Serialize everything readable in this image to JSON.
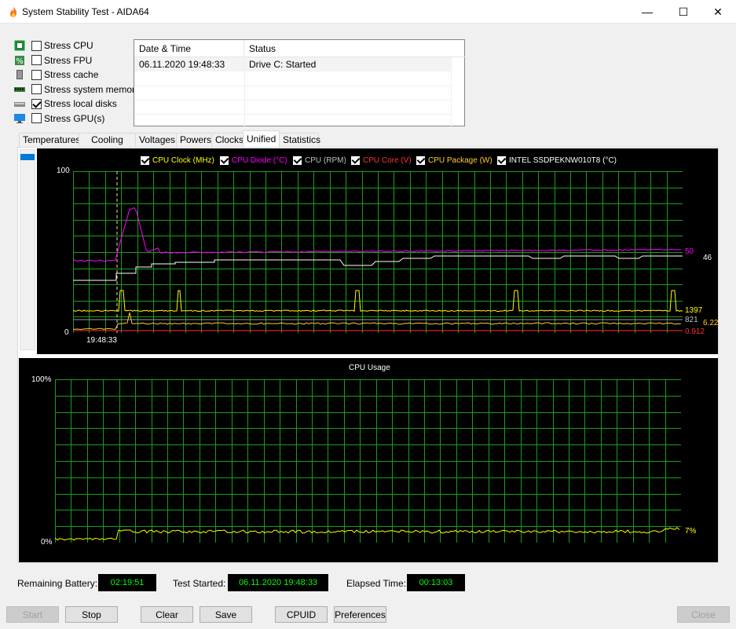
{
  "window": {
    "title": "System Stability Test - AIDA64",
    "controls": {
      "minimize": "—",
      "maximize": "☐",
      "close": "✕"
    }
  },
  "stress_options": [
    {
      "label": "Stress CPU",
      "checked": false,
      "icon": "cpu-icon"
    },
    {
      "label": "Stress FPU",
      "checked": false,
      "icon": "fpu-icon"
    },
    {
      "label": "Stress cache",
      "checked": false,
      "icon": "cache-icon"
    },
    {
      "label": "Stress system memory",
      "checked": false,
      "icon": "memory-icon"
    },
    {
      "label": "Stress local disks",
      "checked": true,
      "icon": "disk-icon"
    },
    {
      "label": "Stress GPU(s)",
      "checked": false,
      "icon": "monitor-icon"
    }
  ],
  "log": {
    "headers": [
      "Date & Time",
      "Status"
    ],
    "rows": [
      [
        "06.11.2020 19:48:33",
        "Drive C: Started"
      ]
    ]
  },
  "tabs": [
    {
      "label": "Temperatures",
      "active": false
    },
    {
      "label": "Cooling Fans",
      "active": false
    },
    {
      "label": "Voltages",
      "active": false
    },
    {
      "label": "Powers",
      "active": false
    },
    {
      "label": "Clocks",
      "active": false
    },
    {
      "label": "Unified",
      "active": true
    },
    {
      "label": "Statistics",
      "active": false
    }
  ],
  "unified_chart": {
    "y_max_label": "100",
    "y_min_label": "0",
    "x_time_label": "19:48:33",
    "legend": [
      {
        "label": "CPU Clock (MHz)",
        "color": "#ffff00",
        "checked": true
      },
      {
        "label": "CPU Diode (°C)",
        "color": "#ff00ff",
        "checked": true
      },
      {
        "label": "CPU (RPM)",
        "color": "#c0c0c0",
        "checked": true
      },
      {
        "label": "CPU Core (V)",
        "color": "#ff3333",
        "checked": true
      },
      {
        "label": "CPU Package (W)",
        "color": "#ffcc33",
        "checked": true
      },
      {
        "label": "INTEL SSDPEKNW010T8 (°C)",
        "color": "#ffffff",
        "checked": true
      }
    ],
    "value_labels": {
      "diode": "50",
      "ssd": "46",
      "clock": "1397",
      "rpm": "821",
      "package": "6.22",
      "core": "0.912"
    }
  },
  "cpu_usage_chart": {
    "title": "CPU Usage",
    "y_max_label": "100%",
    "y_min_label": "0%",
    "current_label": "7%"
  },
  "status": {
    "remaining_battery_label": "Remaining Battery:",
    "remaining_battery_value": "02:19:51",
    "test_started_label": "Test Started:",
    "test_started_value": "06.11.2020 19:48:33",
    "elapsed_time_label": "Elapsed Time:",
    "elapsed_time_value": "00:13:03"
  },
  "buttons": {
    "start": "Start",
    "stop": "Stop",
    "clear": "Clear",
    "save": "Save",
    "cpuid": "CPUID",
    "preferences": "Preferences",
    "close": "Close"
  }
}
